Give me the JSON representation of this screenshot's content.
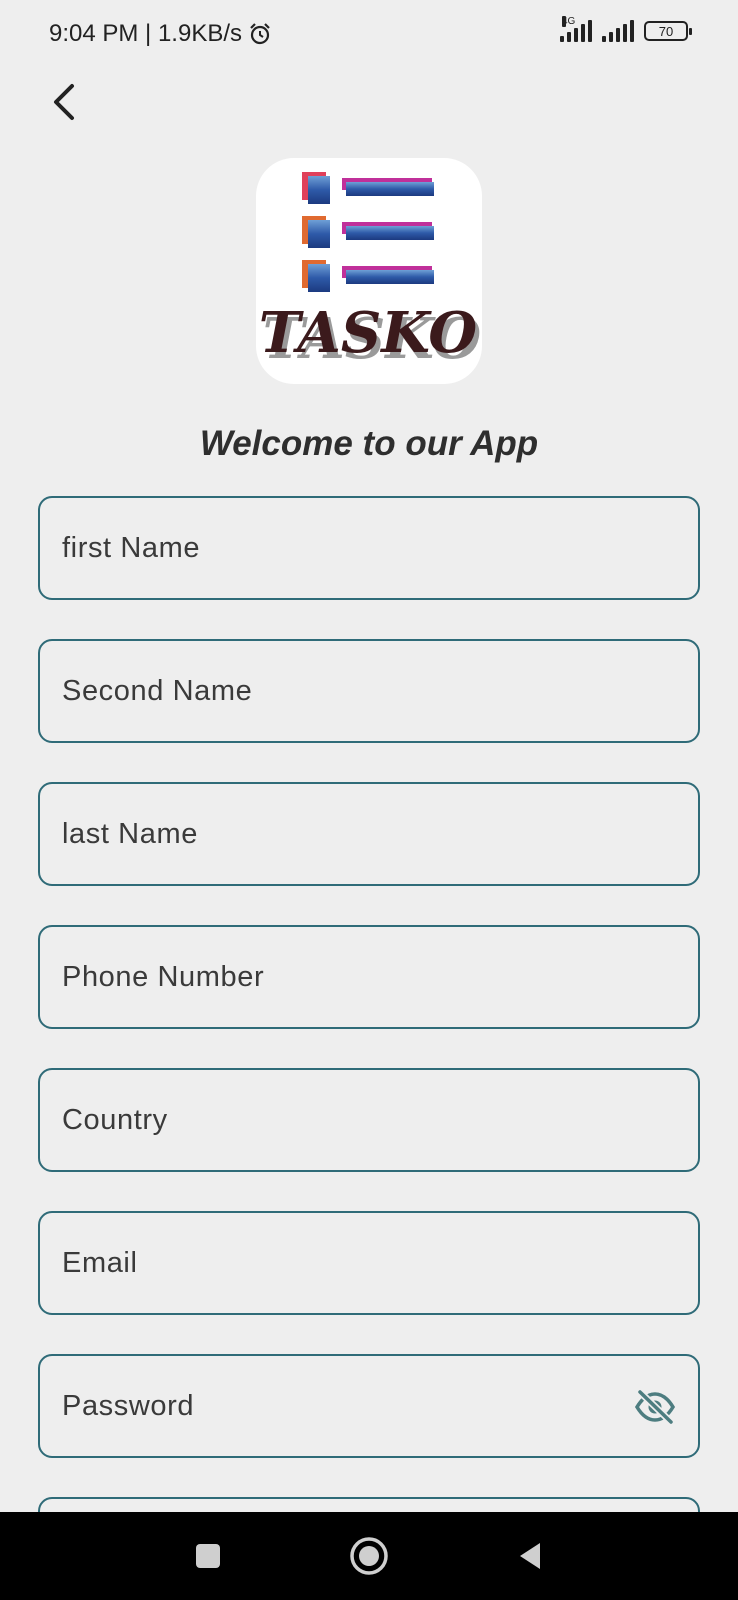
{
  "status_bar": {
    "time_speed": "9:04 PM | 1.9KB/s",
    "net_type": "4G",
    "battery": "70",
    "icons": [
      "alarm-icon",
      "signal-icon",
      "battery-icon"
    ]
  },
  "header": {
    "back_icon": "chevron-left-icon"
  },
  "logo": {
    "text": "TASKO"
  },
  "welcome": "Welcome to our App",
  "form": {
    "first_name": "first Name",
    "second_name": "Second Name",
    "last_name": "last Name",
    "phone": "Phone Number",
    "country": "Country",
    "email": "Email",
    "password": "Password",
    "password_toggle_icon": "eye-off-icon"
  },
  "nav": {
    "icons": [
      "recents-square-icon",
      "home-circle-icon",
      "back-triangle-icon"
    ]
  },
  "colors": {
    "background": "#eeeeee",
    "field_border": "#2f6b78",
    "eye_icon": "#4d7d80"
  }
}
